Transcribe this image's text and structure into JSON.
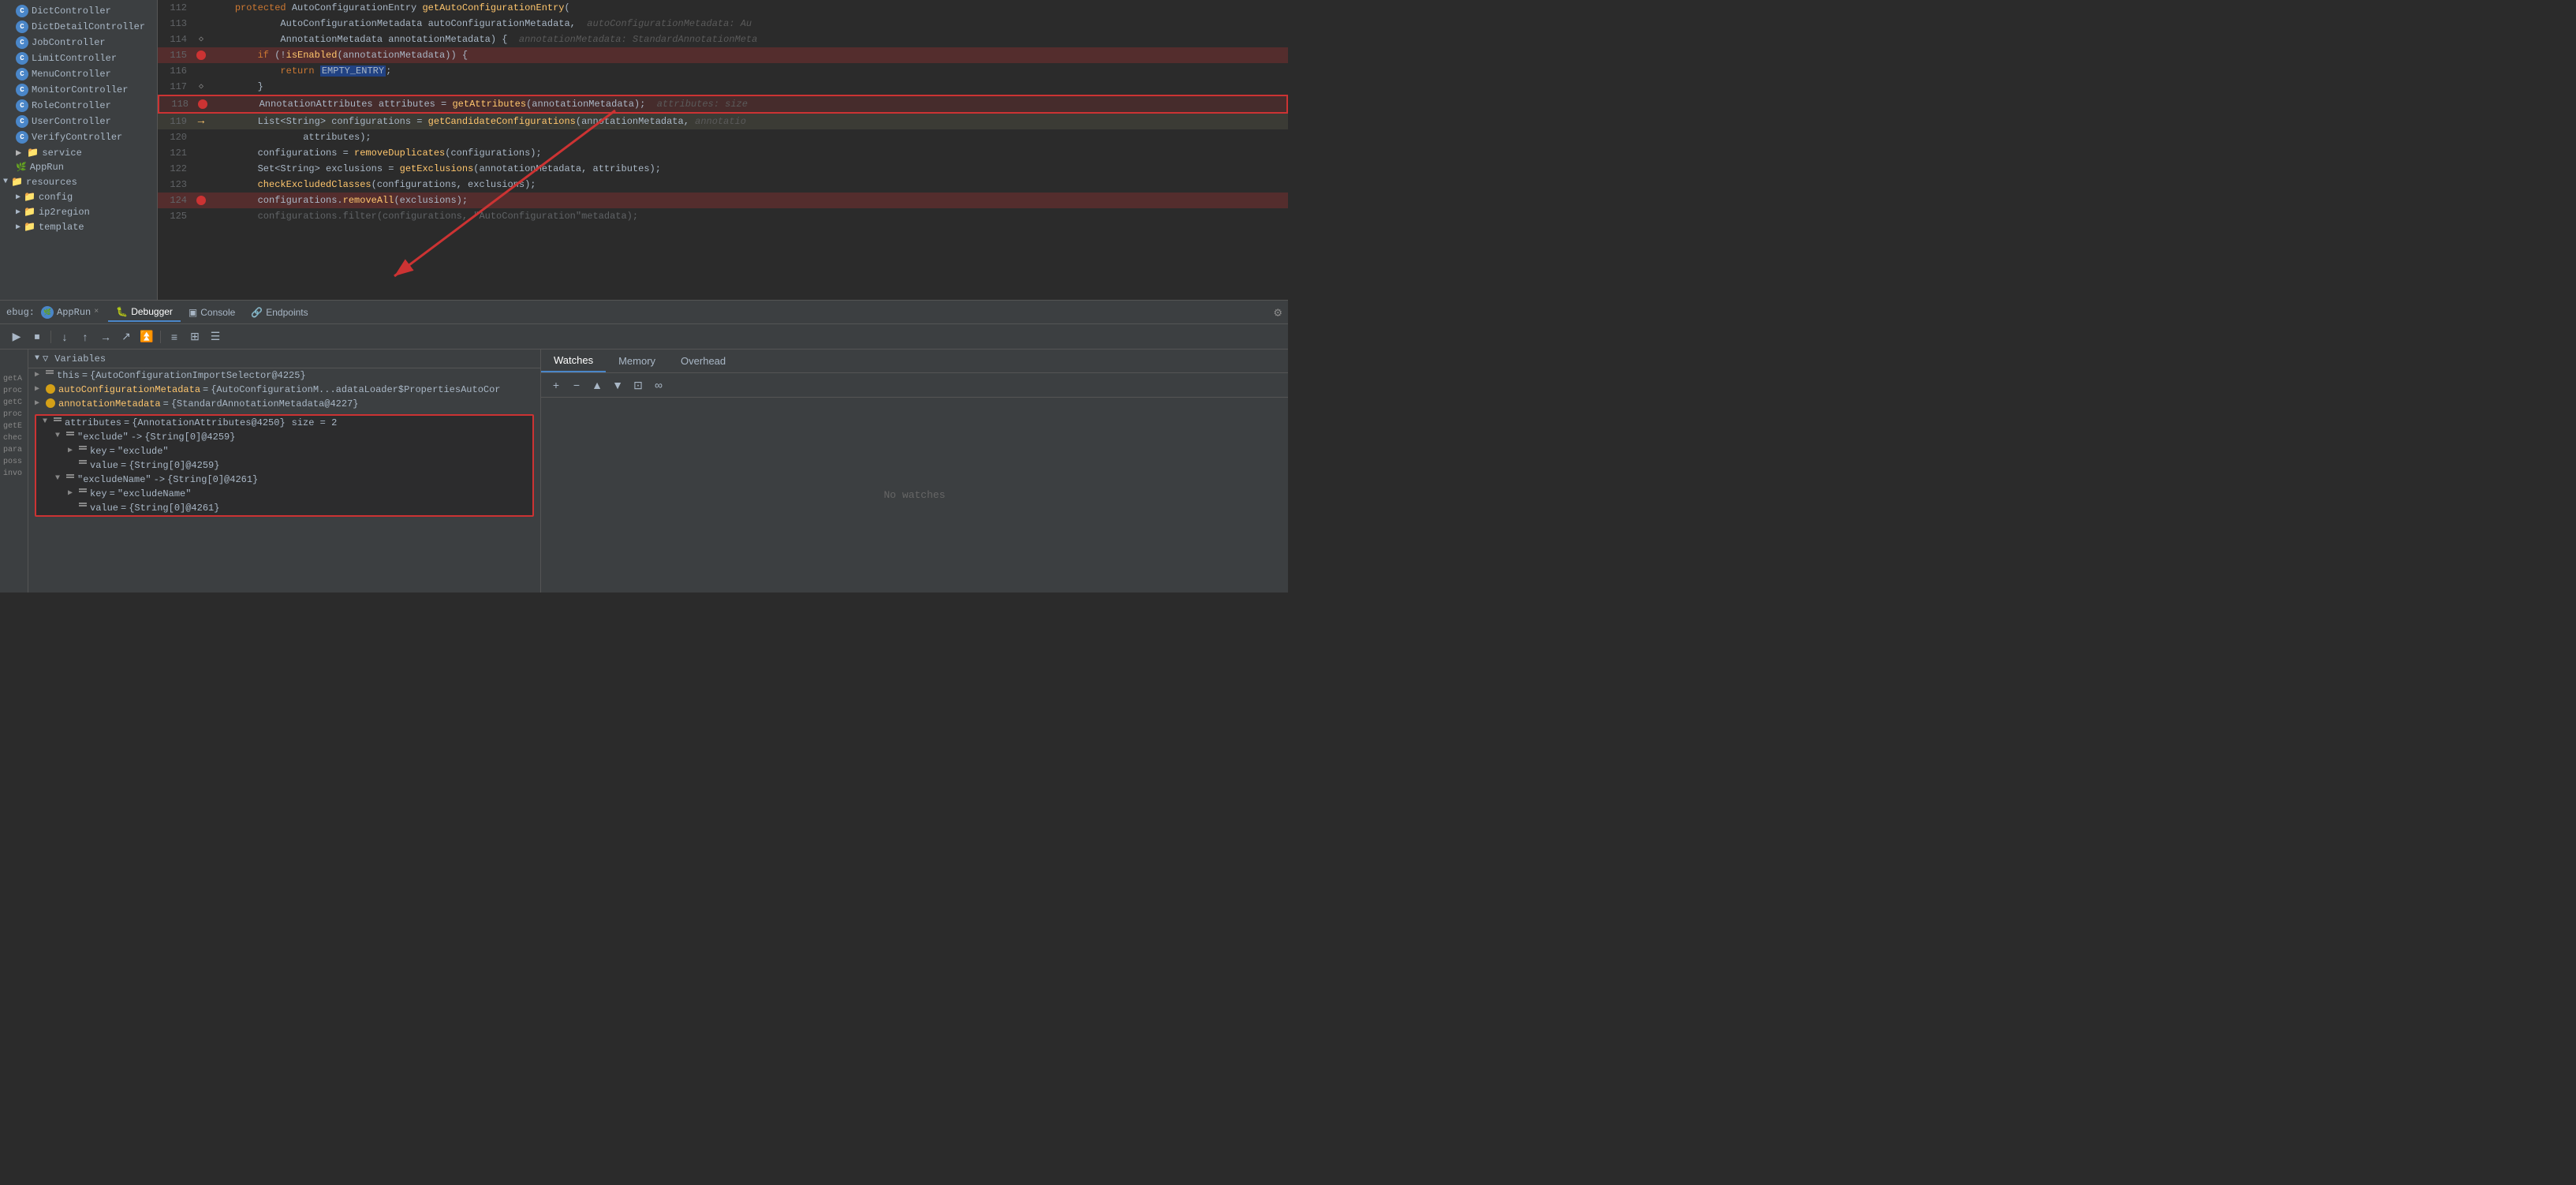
{
  "editor": {
    "lines": [
      {
        "num": "112",
        "gutter": "",
        "content": "    protected AutoConfigurationEntry getAutoConfigurationEntry(",
        "highlight": false,
        "hint": ""
      },
      {
        "num": "113",
        "gutter": "",
        "content": "            AutoConfigurationMetadata autoConfigurationMetadata,",
        "highlight": false,
        "hint": "autoConfigurationMetadata: Au"
      },
      {
        "num": "114",
        "gutter": "bookmark",
        "content": "            AnnotationMetadata annotationMetadata) {",
        "highlight": false,
        "hint": "annotationMetadata: StandardAnnotationMeta"
      },
      {
        "num": "115",
        "gutter": "breakpoint",
        "content": "        if (!isEnabled(annotationMetadata)) {",
        "highlight": true,
        "hint": ""
      },
      {
        "num": "116",
        "gutter": "",
        "content": "            return EMPTY_ENTRY;",
        "highlight": false,
        "hint": ""
      },
      {
        "num": "117",
        "gutter": "bookmark",
        "content": "        }",
        "highlight": false,
        "hint": ""
      },
      {
        "num": "118",
        "gutter": "breakpoint",
        "content": "        AnnotationAttributes attributes = getAttributes(annotationMetadata);",
        "highlight": true,
        "selected": true,
        "hint": "attributes: size"
      },
      {
        "num": "119",
        "gutter": "current",
        "content": "        List<String> configurations = getCandidateConfigurations(annotationMetadata,",
        "highlight": false,
        "hint": "annotatio"
      },
      {
        "num": "120",
        "gutter": "",
        "content": "                attributes);",
        "highlight": false,
        "hint": ""
      },
      {
        "num": "121",
        "gutter": "",
        "content": "        configurations = removeDuplicates(configurations);",
        "highlight": false,
        "hint": ""
      },
      {
        "num": "122",
        "gutter": "",
        "content": "        Set<String> exclusions = getExclusions(annotationMetadata, attributes);",
        "highlight": false,
        "hint": ""
      },
      {
        "num": "123",
        "gutter": "",
        "content": "        checkExcludedClasses(configurations, exclusions);",
        "highlight": false,
        "hint": ""
      },
      {
        "num": "124",
        "gutter": "breakpoint",
        "content": "        configurations.removeAll(exclusions);",
        "highlight": true,
        "hint": ""
      },
      {
        "num": "125",
        "gutter": "",
        "content": "        configurations.filter(configurations, \"AutoConfiguration\"metadata);",
        "highlight": false,
        "hint": ""
      }
    ]
  },
  "file_tree": {
    "items": [
      {
        "label": "DictController",
        "type": "c",
        "indent": 1
      },
      {
        "label": "DictDetailController",
        "type": "c",
        "indent": 1
      },
      {
        "label": "JobController",
        "type": "c",
        "indent": 1
      },
      {
        "label": "LimitController",
        "type": "c",
        "indent": 1
      },
      {
        "label": "MenuController",
        "type": "c",
        "indent": 1
      },
      {
        "label": "MonitorController",
        "type": "c",
        "indent": 1
      },
      {
        "label": "RoleController",
        "type": "c",
        "indent": 1
      },
      {
        "label": "UserController",
        "type": "c",
        "indent": 1
      },
      {
        "label": "VerifyController",
        "type": "c",
        "indent": 1
      },
      {
        "label": "service",
        "type": "folder",
        "indent": 1
      },
      {
        "label": "AppRun",
        "type": "file",
        "indent": 1
      },
      {
        "label": "resources",
        "type": "folder",
        "indent": 0
      },
      {
        "label": "config",
        "type": "folder",
        "indent": 1
      },
      {
        "label": "ip2region",
        "type": "folder",
        "indent": 1
      },
      {
        "label": "template",
        "type": "folder",
        "indent": 1
      }
    ]
  },
  "debugger": {
    "tab_bar": {
      "debug_label": "ebug:",
      "app_label": "AppRun",
      "close": "×",
      "tabs": [
        {
          "label": "Debugger",
          "icon": "🐛",
          "active": true
        },
        {
          "label": "Console",
          "icon": "▣"
        },
        {
          "label": "Endpoints",
          "icon": "🔗"
        }
      ],
      "settings_icon": "⚙"
    },
    "toolbar": {
      "buttons": [
        "▶",
        "⏹",
        "↓",
        "↑",
        "→",
        "↗",
        "⏫",
        "≡",
        "⊞",
        "☰"
      ]
    },
    "variables": {
      "header": "Variables",
      "filter_icon": "▼",
      "items": [
        {
          "indent": 0,
          "arrow": "▶",
          "name": "this",
          "value": "{AutoConfigurationImportSelector@4225}",
          "color": "normal"
        },
        {
          "indent": 0,
          "arrow": "▶",
          "name": "autoConfigurationMetadata",
          "value": "{AutoConfigurationM...adataLoader$PropertiesAutoCor",
          "color": "gold"
        },
        {
          "indent": 0,
          "arrow": "▶",
          "name": "annotationMetadata",
          "value": "{StandardAnnotationMetadata@4227}",
          "color": "gold"
        },
        {
          "indent": 0,
          "arrow": "▼",
          "name": "attributes",
          "value": "{AnnotationAttributes@4250}",
          "extra": "size = 2",
          "color": "normal",
          "highlighted": true
        },
        {
          "indent": 1,
          "arrow": "▼",
          "name": "\"exclude\"",
          "value": "-> {String[0]@4259}",
          "color": "normal",
          "highlighted": true
        },
        {
          "indent": 2,
          "arrow": "▶",
          "name": "key",
          "value": "= \"exclude\"",
          "color": "normal",
          "highlighted": true
        },
        {
          "indent": 2,
          "arrow": "  ",
          "name": "value",
          "value": "= {String[0]@4259}",
          "color": "normal",
          "highlighted": true
        },
        {
          "indent": 1,
          "arrow": "▼",
          "name": "\"excludeName\"",
          "value": "-> {String[0]@4261}",
          "color": "normal",
          "highlighted": true
        },
        {
          "indent": 2,
          "arrow": "▶",
          "name": "key",
          "value": "= \"excludeName\"",
          "color": "normal",
          "highlighted": true
        },
        {
          "indent": 2,
          "arrow": "  ",
          "name": "value",
          "value": "= {String[0]@4261}",
          "color": "normal",
          "highlighted": true
        }
      ],
      "left_labels": [
        "getA",
        "proc",
        "getC",
        "proc",
        "getE",
        "chec",
        "para",
        "poss",
        "invo"
      ]
    }
  },
  "right_panel": {
    "tabs": [
      {
        "label": "Watches",
        "active": true
      },
      {
        "label": "Memory",
        "active": false
      },
      {
        "label": "Overhead",
        "active": false
      }
    ],
    "watches_toolbar": {
      "buttons": [
        "+",
        "−",
        "▲",
        "▼",
        "⊡",
        "∞"
      ]
    },
    "no_watches": "No watches"
  }
}
